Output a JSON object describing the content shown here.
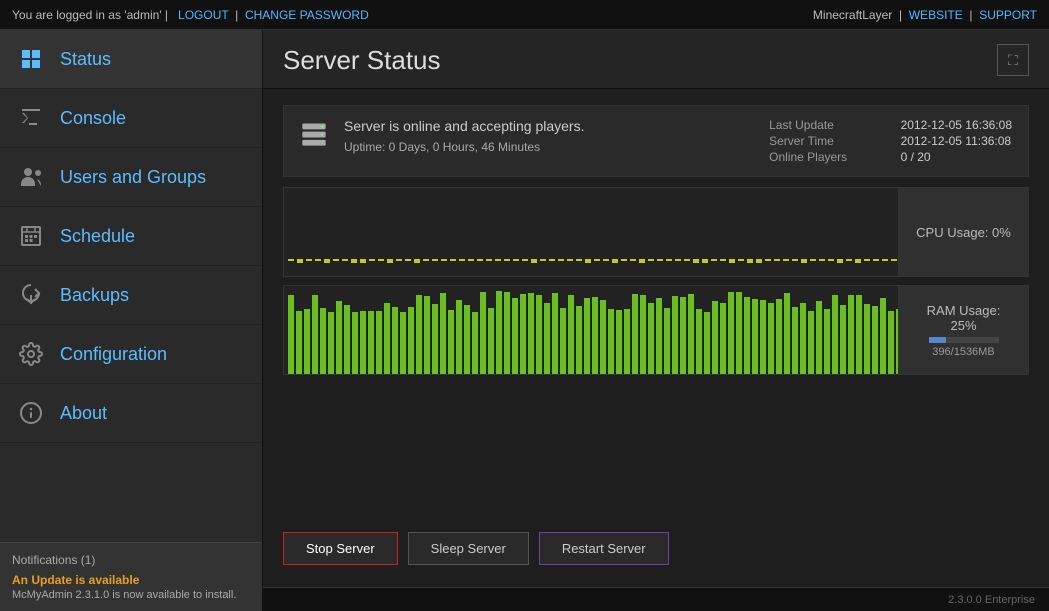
{
  "topbar": {
    "logged_in_text": "You are logged in as 'admin' |",
    "logout_label": "LOGOUT",
    "change_password_label": "CHANGE PASSWORD",
    "brand": "MinecraftLayer",
    "website_label": "WEBSITE",
    "support_label": "SUPPORT"
  },
  "sidebar": {
    "items": [
      {
        "id": "status",
        "label": "Status",
        "icon": "status-icon",
        "active": true
      },
      {
        "id": "console",
        "label": "Console",
        "icon": "console-icon",
        "active": false
      },
      {
        "id": "users-groups",
        "label": "Users and Groups",
        "icon": "users-icon",
        "active": false
      },
      {
        "id": "schedule",
        "label": "Schedule",
        "icon": "schedule-icon",
        "active": false
      },
      {
        "id": "backups",
        "label": "Backups",
        "icon": "backups-icon",
        "active": false
      },
      {
        "id": "configuration",
        "label": "Configuration",
        "icon": "config-icon",
        "active": false
      },
      {
        "id": "about",
        "label": "About",
        "icon": "about-icon",
        "active": false
      }
    ]
  },
  "notifications": {
    "title": "Notifications (1)",
    "message": "An Update is available",
    "description": "McMyAdmin 2.3.1.0 is now available to install."
  },
  "main": {
    "title": "Server Status",
    "status_message": "Server is online and accepting players.",
    "uptime": "Uptime: 0 Days, 0 Hours, 46 Minutes",
    "last_update_label": "Last Update",
    "last_update_value": "2012-12-05 16:36:08",
    "server_time_label": "Server Time",
    "server_time_value": "2012-12-05 11:36:08",
    "online_players_label": "Online Players",
    "online_players_value": "0 / 20",
    "cpu_usage": "CPU Usage: 0%",
    "ram_usage_label": "RAM Usage:",
    "ram_usage_pct": "25%",
    "ram_usage_mem": "396/1536MB",
    "ram_bar_fill_pct": 25,
    "buttons": {
      "stop": "Stop Server",
      "sleep": "Sleep Server",
      "restart": "Restart Server"
    }
  },
  "version": "2.3.0.0 Enterprise"
}
